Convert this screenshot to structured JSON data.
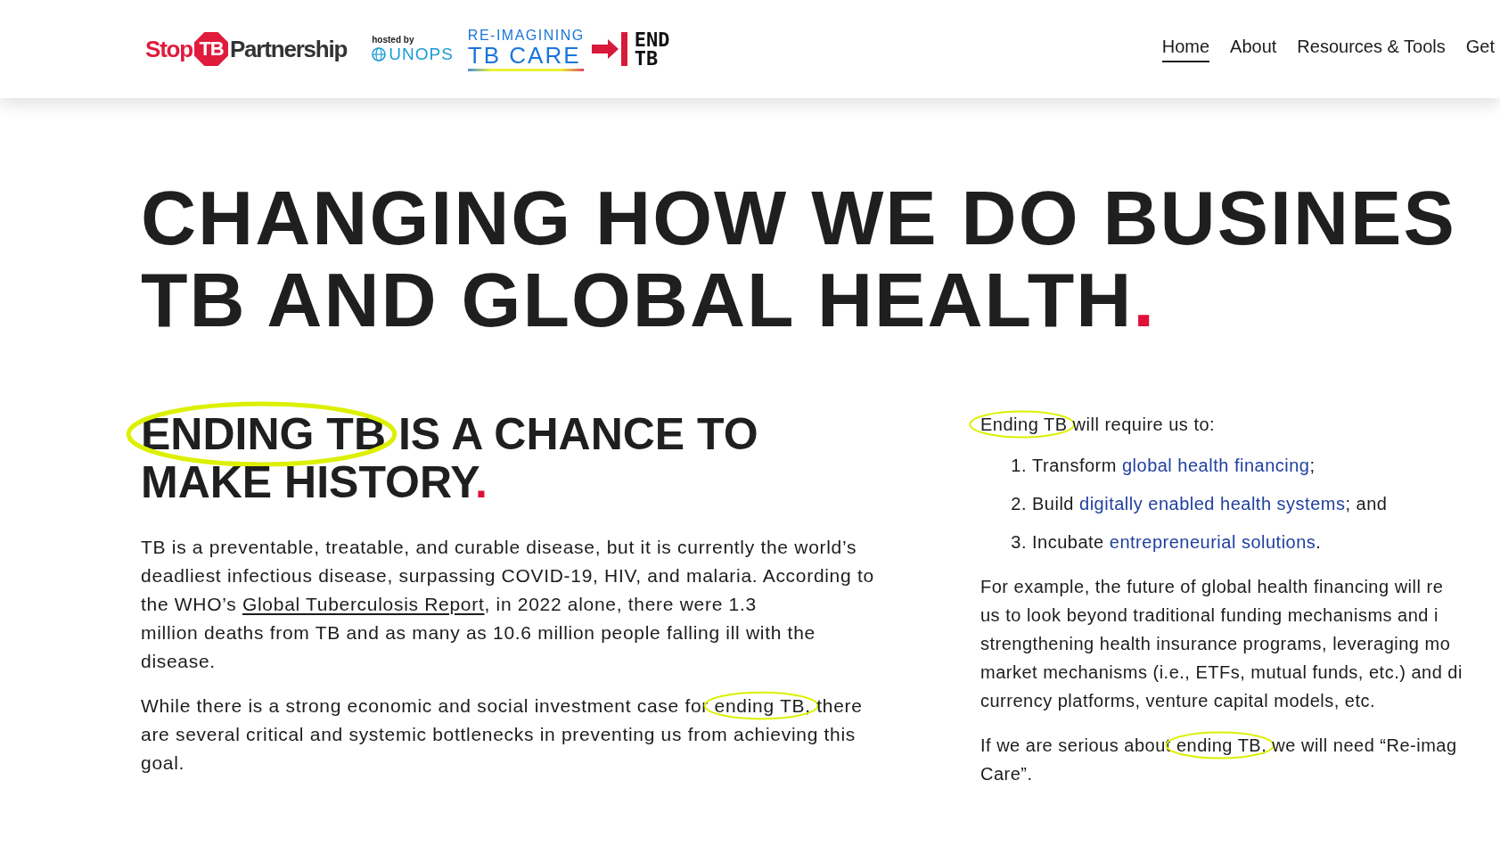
{
  "header": {
    "logos": {
      "stop_tb": {
        "left": "Stop",
        "badge": "TB",
        "right": "Partnership"
      },
      "unops": {
        "hosted_by": "hosted by",
        "name": "UNOPS"
      },
      "reimagining": {
        "line1": "RE-IMAGINING",
        "line2": "TB CARE"
      },
      "end_tb": {
        "line1": "END",
        "line2": "TB"
      }
    },
    "nav": [
      {
        "label": "Home",
        "selected": true
      },
      {
        "label": "About",
        "selected": false
      },
      {
        "label": "Resources & Tools",
        "selected": false
      },
      {
        "label": "Get",
        "selected": false
      }
    ]
  },
  "hero": {
    "lines": [
      "CHANGING HOW WE DO BUSINES",
      "TB AND GLOBAL HEALTH"
    ],
    "end_mark": "."
  },
  "left": {
    "heading": {
      "lines": [
        [
          {
            "kind": "circled",
            "text": "ENDING TB"
          },
          {
            "kind": "plain",
            "text": " IS A CHANCE TO"
          }
        ],
        [
          {
            "kind": "plain",
            "text": "MAKE HISTORY"
          }
        ]
      ],
      "end_mark": "."
    },
    "paragraphs": [
      {
        "lines": [
          [
            {
              "kind": "plain",
              "text": "TB is a preventable, treatable, and curable disease, but it is currently the world’s"
            }
          ],
          [
            {
              "kind": "plain",
              "text": "deadliest infectious disease, surpassing COVID-19, HIV, and malaria. According to"
            }
          ],
          [
            {
              "kind": "plain",
              "text": "the WHO’s "
            },
            {
              "kind": "link",
              "text": "Global Tuberculosis Report"
            },
            {
              "kind": "plain",
              "text": ", in 2022 alone, there were 1.3"
            }
          ],
          [
            {
              "kind": "plain",
              "text": "million deaths from TB and as many as 10.6 million people falling ill with the"
            }
          ],
          [
            {
              "kind": "plain",
              "text": "disease."
            }
          ]
        ]
      },
      {
        "lines": [
          [
            {
              "kind": "plain",
              "text": "While there is a strong economic and social investment case for "
            },
            {
              "kind": "circled",
              "text": "ending TB,"
            },
            {
              "kind": "plain",
              "text": " there"
            }
          ],
          [
            {
              "kind": "plain",
              "text": "are several critical and systemic bottlenecks in preventing us from achieving this"
            }
          ],
          [
            {
              "kind": "plain",
              "text": "goal."
            }
          ]
        ]
      }
    ]
  },
  "right": {
    "intro": {
      "lines": [
        [
          {
            "kind": "circled",
            "text": "Ending TB"
          },
          {
            "kind": "plain",
            "text": " will require us to:"
          }
        ]
      ]
    },
    "list": [
      {
        "number": "1.",
        "segments": [
          {
            "kind": "plain",
            "text": "Transform "
          },
          {
            "kind": "blue_link",
            "text": "global health financing"
          },
          {
            "kind": "plain",
            "text": ";"
          }
        ]
      },
      {
        "number": "2.",
        "segments": [
          {
            "kind": "plain",
            "text": "Build "
          },
          {
            "kind": "blue_link",
            "text": "digitally enabled health systems"
          },
          {
            "kind": "plain",
            "text": "; and"
          }
        ]
      },
      {
        "number": "3.",
        "segments": [
          {
            "kind": "plain",
            "text": "Incubate "
          },
          {
            "kind": "blue_link",
            "text": "entrepreneurial solutions"
          },
          {
            "kind": "plain",
            "text": "."
          }
        ]
      }
    ],
    "paragraphs": [
      {
        "lines": [
          [
            {
              "kind": "plain",
              "text": "For example, the future of global health financing will re"
            }
          ],
          [
            {
              "kind": "plain",
              "text": "us to look beyond traditional funding mechanisms and i"
            }
          ],
          [
            {
              "kind": "plain",
              "text": "strengthening health insurance programs, leveraging mo"
            }
          ],
          [
            {
              "kind": "plain",
              "text": "market mechanisms (i.e., ETFs, mutual funds, etc.) and di"
            }
          ],
          [
            {
              "kind": "plain",
              "text": "currency platforms, venture capital models, etc."
            }
          ]
        ]
      },
      {
        "lines": [
          [
            {
              "kind": "plain",
              "text": "If we are serious about "
            },
            {
              "kind": "circled",
              "text": "ending TB,"
            },
            {
              "kind": "plain",
              "text": " we will need “Re-imag"
            }
          ],
          [
            {
              "kind": "plain",
              "text": "Care”."
            }
          ]
        ]
      }
    ]
  }
}
